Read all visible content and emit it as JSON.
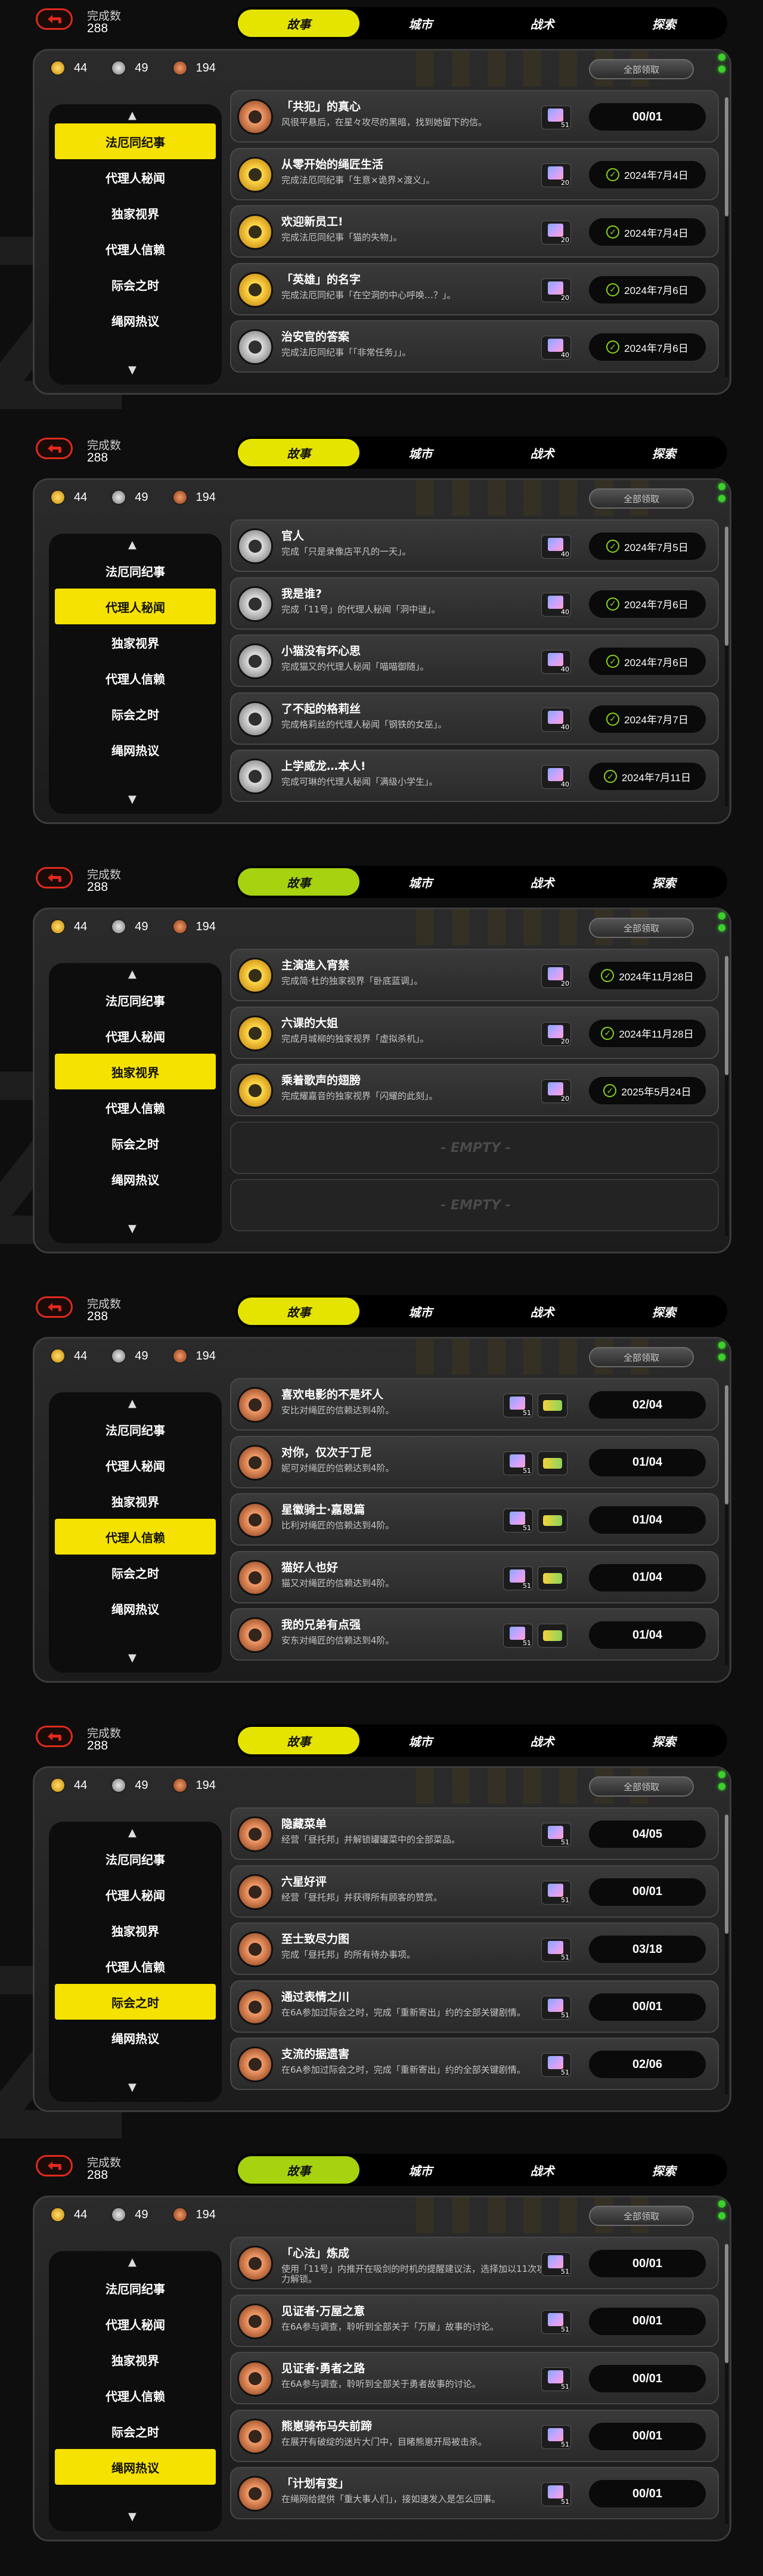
{
  "screens": [
    {
      "done_label": "完成数",
      "done_value": "288",
      "tabs": [
        "故事",
        "城市",
        "战术",
        "探索"
      ],
      "active_tab": 0,
      "currencies": [
        "44",
        "49",
        "194"
      ],
      "claim_all": "全部领取",
      "sidebar": [
        "法厄同纪事",
        "代理人秘闻",
        "独家视界",
        "代理人信赖",
        "际会之时",
        "绳网热议"
      ],
      "active_side": 0,
      "rows": [
        {
          "medal": "bronze",
          "title": "「共犯」的真心",
          "desc": "风很平悬后，在星々攻尽的黑暗，找到她留下的信。",
          "reward": "51",
          "progress": "00/01"
        },
        {
          "medal": "gold",
          "title": "从零开始的绳匠生活",
          "desc": "完成法厄同纪事「生意×诡界×渡义」。",
          "reward": "20",
          "date": "2024年7月4日"
        },
        {
          "medal": "gold",
          "title": "欢迎新员工!",
          "desc": "完成法厄同纪事「猫的失物」。",
          "reward": "20",
          "date": "2024年7月4日"
        },
        {
          "medal": "gold",
          "title": "「英雄」的名字",
          "desc": "完成法厄同纪事「在空洞的中心呼唤…？」。",
          "reward": "20",
          "date": "2024年7月6日"
        },
        {
          "medal": "silver",
          "title": "治安官的答案",
          "desc": "完成法厄同纪事「「非常任务」」。",
          "reward": "40",
          "date": "2024年7月6日"
        }
      ]
    },
    {
      "done_label": "完成数",
      "done_value": "288",
      "tabs": [
        "故事",
        "城市",
        "战术",
        "探索"
      ],
      "active_tab": 0,
      "currencies": [
        "44",
        "49",
        "194"
      ],
      "claim_all": "全部领取",
      "sidebar": [
        "法厄同纪事",
        "代理人秘闻",
        "独家视界",
        "代理人信赖",
        "际会之时",
        "绳网热议"
      ],
      "active_side": 1,
      "rows": [
        {
          "medal": "silver",
          "title": "官人",
          "desc": "完成「只是录像店平凡的一天」。",
          "reward": "40",
          "date": "2024年7月5日"
        },
        {
          "medal": "silver",
          "title": "我是谁?",
          "desc": "完成「11号」的代理人秘闻「洞中谜」。",
          "reward": "40",
          "date": "2024年7月6日"
        },
        {
          "medal": "silver",
          "title": "小猫没有坏心思",
          "desc": "完成猫又的代理人秘闻「喵喵御随」。",
          "reward": "40",
          "date": "2024年7月6日"
        },
        {
          "medal": "silver",
          "title": "了不起的格莉丝",
          "desc": "完成格莉丝的代理人秘闻「钢铁的女巫」。",
          "reward": "40",
          "date": "2024年7月7日"
        },
        {
          "medal": "silver",
          "title": "上学威龙…本人!",
          "desc": "完成可琳的代理人秘闻「满级小学生」。",
          "reward": "40",
          "date": "2024年7月11日"
        }
      ]
    },
    {
      "done_label": "完成数",
      "done_value": "288",
      "tabs": [
        "故事",
        "城市",
        "战术",
        "探索"
      ],
      "active_tab": 0,
      "lime": true,
      "currencies": [
        "44",
        "49",
        "194"
      ],
      "claim_all": "全部领取",
      "sidebar": [
        "法厄同纪事",
        "代理人秘闻",
        "独家视界",
        "代理人信赖",
        "际会之时",
        "绳网热议"
      ],
      "active_side": 2,
      "rows": [
        {
          "medal": "gold",
          "title": "主演進入宵禁",
          "desc": "完成简·杜的独家视界「卧底蓝调」。",
          "reward": "20",
          "date": "2024年11月28日"
        },
        {
          "medal": "gold",
          "title": "六课的大姐",
          "desc": "完成月城柳的独家视界「虚拟杀机」。",
          "reward": "20",
          "date": "2024年11月28日"
        },
        {
          "medal": "gold",
          "title": "乘着歌声的翅膀",
          "desc": "完成耀嘉音的独家视界「闪耀的此刻」。",
          "reward": "20",
          "date": "2025年5月24日"
        },
        {
          "empty": "- EMPTY -"
        },
        {
          "empty": "- EMPTY -"
        }
      ]
    },
    {
      "done_label": "完成数",
      "done_value": "288",
      "tabs": [
        "故事",
        "城市",
        "战术",
        "探索"
      ],
      "active_tab": 0,
      "currencies": [
        "44",
        "49",
        "194"
      ],
      "claim_all": "全部领取",
      "sidebar": [
        "法厄同纪事",
        "代理人秘闻",
        "独家视界",
        "代理人信赖",
        "际会之时",
        "绳网热议"
      ],
      "active_side": 3,
      "rows": [
        {
          "medal": "bronze",
          "title": "喜欢电影的不是坏人",
          "desc": "安比对绳匠的信赖达到4阶。",
          "reward": "51",
          "extra": true,
          "progress": "02/04"
        },
        {
          "medal": "bronze",
          "title": "对你，仅次于丁尼",
          "desc": "妮可对绳匠的信赖达到4阶。",
          "reward": "51",
          "extra": true,
          "progress": "01/04"
        },
        {
          "medal": "bronze",
          "title": "星徽骑士·嘉恩篇",
          "desc": "比利对绳匠的信赖达到4阶。",
          "reward": "51",
          "extra": true,
          "progress": "01/04"
        },
        {
          "medal": "bronze",
          "title": "猫好人也好",
          "desc": "猫又对绳匠的信赖达到4阶。",
          "reward": "51",
          "extra": true,
          "progress": "01/04"
        },
        {
          "medal": "bronze",
          "title": "我的兄弟有点强",
          "desc": "安东对绳匠的信赖达到4阶。",
          "reward": "51",
          "extra": true,
          "progress": "01/04"
        }
      ]
    },
    {
      "done_label": "完成数",
      "done_value": "288",
      "tabs": [
        "故事",
        "城市",
        "战术",
        "探索"
      ],
      "active_tab": 0,
      "currencies": [
        "44",
        "49",
        "194"
      ],
      "claim_all": "全部领取",
      "sidebar": [
        "法厄同纪事",
        "代理人秘闻",
        "独家视界",
        "代理人信赖",
        "际会之时",
        "绳网热议"
      ],
      "active_side": 4,
      "rows": [
        {
          "medal": "bronze",
          "title": "隐藏菜单",
          "desc": "经营「昼托邦」并解锁罐罐菜中的全部菜品。",
          "reward": "51",
          "progress": "04/05"
        },
        {
          "medal": "bronze",
          "title": "六星好评",
          "desc": "经营「昼托邦」并获得所有顾客的赞赏。",
          "reward": "51",
          "progress": "00/01"
        },
        {
          "medal": "bronze",
          "title": "至士致尽力图",
          "desc": "完成「昼托邦」的所有待办事项。",
          "reward": "51",
          "progress": "03/18"
        },
        {
          "medal": "bronze",
          "title": "通过表情之川",
          "desc": "在6A参加过际会之时，完成「重新寄出」约的全部关键剧情。",
          "reward": "51",
          "progress": "00/01"
        },
        {
          "medal": "bronze",
          "title": "支流的据遗害",
          "desc": "在6A参加过际会之时，完成「重新寄出」约的全部关键剧情。",
          "reward": "51",
          "progress": "02/06"
        }
      ]
    },
    {
      "done_label": "完成数",
      "done_value": "288",
      "tabs": [
        "故事",
        "城市",
        "战术",
        "探索"
      ],
      "active_tab": 0,
      "lime": true,
      "currencies": [
        "44",
        "49",
        "194"
      ],
      "claim_all": "全部领取",
      "sidebar": [
        "法厄同纪事",
        "代理人秘闻",
        "独家视界",
        "代理人信赖",
        "际会之时",
        "绳网热议"
      ],
      "active_side": 5,
      "rows": [
        {
          "medal": "bronze",
          "title": "「心法」炼成",
          "desc": "使用「11号」内推开在吸剑的时机的提醒建议法，选择加以11次攻击力解锁。",
          "reward": "51",
          "progress": "00/01"
        },
        {
          "medal": "bronze",
          "title": "见证者·万屋之意",
          "desc": "在6A参与调查，聆听到全部关于「万屋」故事的讨论。",
          "reward": "51",
          "progress": "00/01"
        },
        {
          "medal": "bronze",
          "title": "见证者·勇者之路",
          "desc": "在6A参与调查，聆听到全部关于勇者故事的讨论。",
          "reward": "51",
          "progress": "00/01"
        },
        {
          "medal": "bronze",
          "title": "熊崽骑布马失前蹄",
          "desc": "在展开有破绽的迷片大门中，目睹熊崽开局被击杀。",
          "reward": "51",
          "progress": "00/01"
        },
        {
          "medal": "bronze",
          "title": "「计划有变」",
          "desc": "在绳网给提供「重大事人们」，接如速发入是怎么回事。",
          "reward": "51",
          "progress": "00/01"
        }
      ]
    }
  ]
}
